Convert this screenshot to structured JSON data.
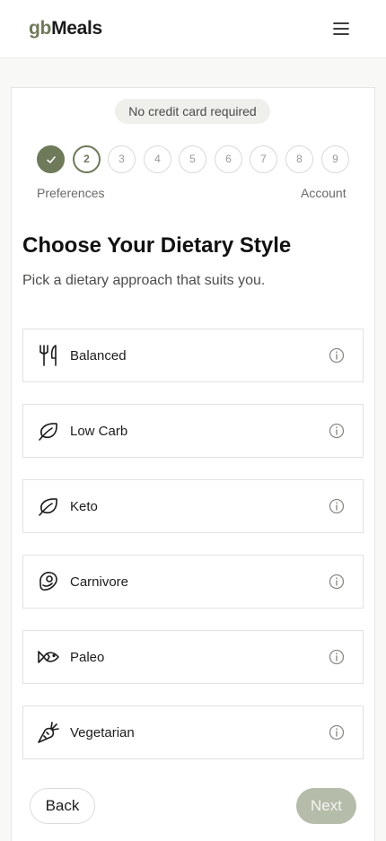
{
  "header": {
    "logo_prefix": "gb",
    "logo_suffix": "Meals",
    "menu_icon": "hamburger-menu-icon"
  },
  "badge": "No credit card required",
  "stepper": {
    "steps": [
      "",
      "2",
      "3",
      "4",
      "5",
      "6",
      "7",
      "8",
      "9"
    ],
    "completed_step": 1,
    "current_step": 2,
    "start_label": "Preferences",
    "end_label": "Account",
    "accent_color": "#6e7a5a"
  },
  "main": {
    "title": "Choose Your Dietary Style",
    "subtitle": "Pick a dietary approach that suits you."
  },
  "options": [
    {
      "label": "Balanced",
      "icon": "utensils-icon"
    },
    {
      "label": "Low Carb",
      "icon": "leaf-icon"
    },
    {
      "label": "Keto",
      "icon": "leaf-icon"
    },
    {
      "label": "Carnivore",
      "icon": "steak-icon"
    },
    {
      "label": "Paleo",
      "icon": "fish-icon"
    },
    {
      "label": "Vegetarian",
      "icon": "carrot-icon"
    }
  ],
  "footer": {
    "back_label": "Back",
    "next_label": "Next"
  }
}
